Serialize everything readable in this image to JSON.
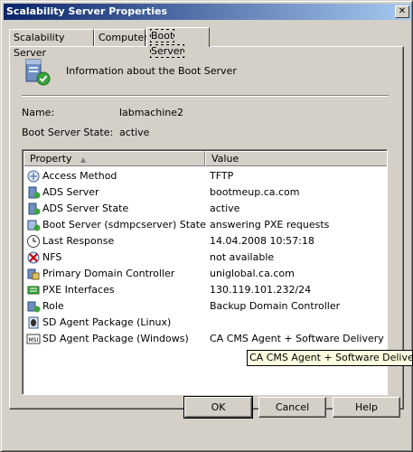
{
  "window": {
    "title": "Scalability Server Properties",
    "close_glyph": "✕"
  },
  "tabs": [
    {
      "label": "Scalability Server"
    },
    {
      "label": "Computer"
    },
    {
      "label": "Boot Server",
      "active": true
    }
  ],
  "header": {
    "info": "Information about the Boot Server",
    "icon": "server-icon"
  },
  "fields": {
    "name_label": "Name:",
    "name_value": "labmachine2",
    "state_label": "Boot Server State:",
    "state_value": "active"
  },
  "list": {
    "columns": {
      "property": "Property",
      "value": "Value",
      "sort_glyph": "▲"
    },
    "rows": [
      {
        "property": "Access Method",
        "value": "TFTP",
        "icon": "access-method-icon"
      },
      {
        "property": "ADS Server",
        "value": "bootmeup.ca.com",
        "icon": "ads-server-icon"
      },
      {
        "property": "ADS Server State",
        "value": "active",
        "icon": "ads-state-icon"
      },
      {
        "property": "Boot Server (sdmpcserver) State",
        "value": "answering PXE requests",
        "icon": "boot-state-icon"
      },
      {
        "property": "Last Response",
        "value": "14.04.2008 10:57:18",
        "icon": "clock-icon"
      },
      {
        "property": "NFS",
        "value": "not available",
        "icon": "nfs-icon"
      },
      {
        "property": "Primary Domain Controller",
        "value": "uniglobal.ca.com",
        "icon": "domain-controller-icon"
      },
      {
        "property": "PXE Interfaces",
        "value": "130.119.101.232/24",
        "icon": "pxe-interfaces-icon"
      },
      {
        "property": "Role",
        "value": "Backup Domain Controller",
        "icon": "role-icon"
      },
      {
        "property": "SD Agent Package (Linux)",
        "value": "",
        "icon": "linux-package-icon"
      },
      {
        "property": "SD Agent Package (Windows)",
        "value": "CA CMS Agent + Software Delivery p...",
        "icon": "msi-package-icon"
      }
    ]
  },
  "tooltip": "CA CMS Agent + Software Delivery pl",
  "buttons": {
    "ok": "OK",
    "cancel": "Cancel",
    "help": "Help"
  }
}
